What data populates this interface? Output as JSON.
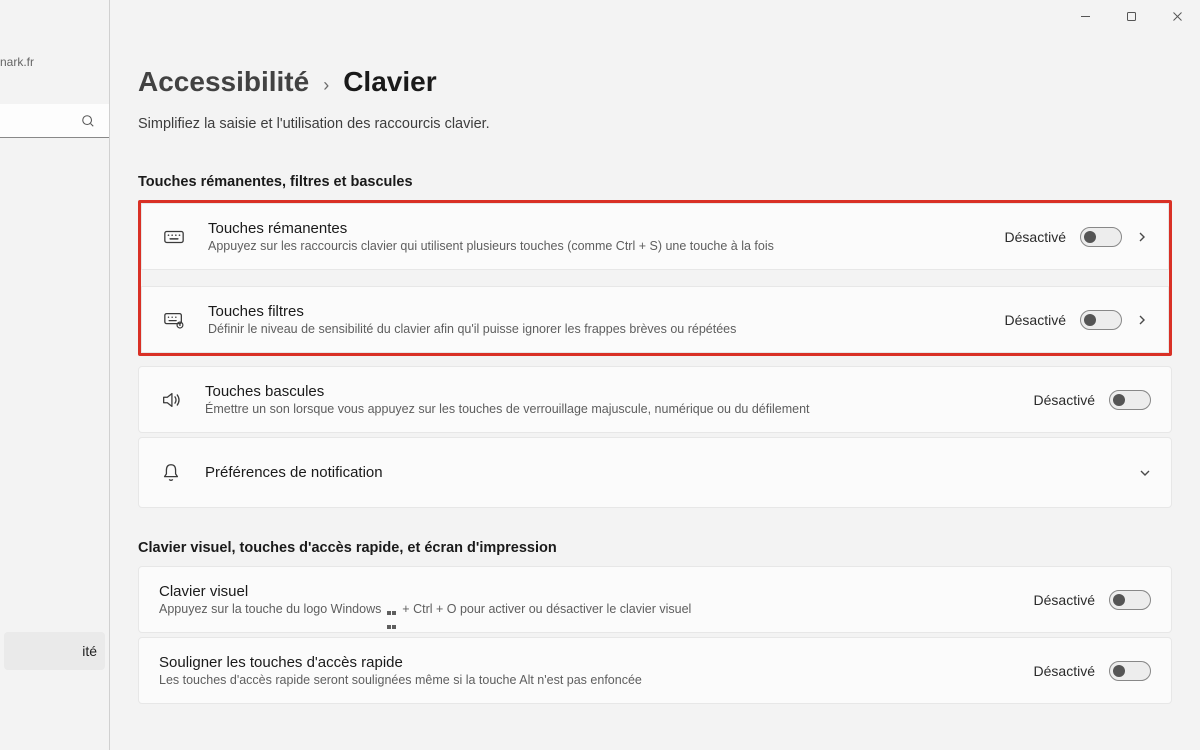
{
  "window": {
    "minimize": "—",
    "maximize": "▢",
    "close": "✕"
  },
  "sidebar": {
    "user_email_fragment": "nark.fr",
    "search_placeholder": "",
    "nav_active_fragment": "ité"
  },
  "breadcrumb": {
    "parent": "Accessibilité",
    "separator": "›",
    "current": "Clavier"
  },
  "subtitle": "Simplifiez la saisie et l'utilisation des raccourcis clavier.",
  "sections": {
    "s1_title": "Touches rémanentes, filtres et bascules",
    "s2_title": "Clavier visuel, touches d'accès rapide, et écran d'impression"
  },
  "toggle_off": "Désactivé",
  "items": {
    "sticky": {
      "title": "Touches rémanentes",
      "desc": "Appuyez sur les raccourcis clavier qui utilisent plusieurs touches (comme Ctrl + S) une touche à la fois",
      "state": "Désactivé"
    },
    "filter": {
      "title": "Touches filtres",
      "desc": "Définir le niveau de sensibilité du clavier afin qu'il puisse ignorer les frappes brèves ou répétées",
      "state": "Désactivé"
    },
    "togglekeys": {
      "title": "Touches bascules",
      "desc": "Émettre un son lorsque vous appuyez sur les touches de verrouillage majuscule, numérique ou du défilement",
      "state": "Désactivé"
    },
    "notif": {
      "title": "Préférences de notification"
    },
    "osk": {
      "title": "Clavier visuel",
      "desc_before": "Appuyez sur la touche du logo Windows ",
      "desc_after": " + Ctrl + O pour activer ou désactiver le clavier visuel",
      "state": "Désactivé"
    },
    "underline": {
      "title": "Souligner les touches d'accès rapide",
      "desc": "Les touches d'accès rapide seront soulignées même si la touche Alt n'est pas enfoncée",
      "state": "Désactivé"
    }
  }
}
